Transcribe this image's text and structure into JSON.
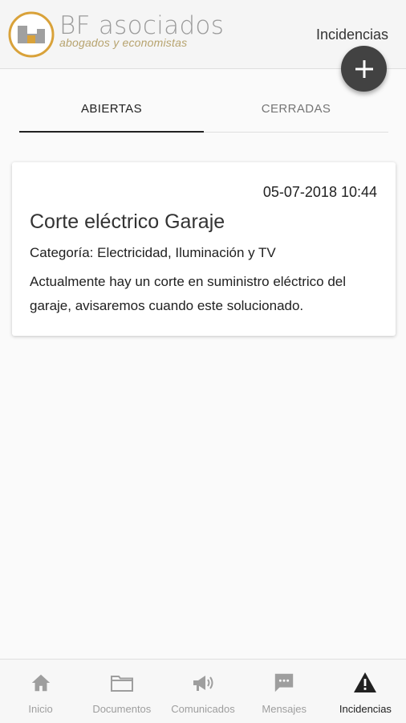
{
  "header": {
    "brand_name": "BF asociados",
    "brand_subtitle": "abogados y economistas",
    "title": "Incidencias"
  },
  "fab": {
    "icon": "plus-icon"
  },
  "tabs": [
    {
      "label": "ABIERTAS",
      "active": true
    },
    {
      "label": "CERRADAS",
      "active": false
    }
  ],
  "incidents": [
    {
      "date": "05-07-2018 10:44",
      "title": "Corte eléctrico Garaje",
      "category": "Categoría: Electricidad, Iluminación y TV",
      "description": "Actualmente hay un corte en suministro eléctrico del garaje, avisaremos cuando este solucionado."
    }
  ],
  "bottom_nav": [
    {
      "label": "Inicio",
      "icon": "home-icon",
      "active": false
    },
    {
      "label": "Documentos",
      "icon": "folder-icon",
      "active": false
    },
    {
      "label": "Comunicados",
      "icon": "megaphone-icon",
      "active": false
    },
    {
      "label": "Mensajes",
      "icon": "chat-icon",
      "active": false
    },
    {
      "label": "Incidencias",
      "icon": "warning-icon",
      "active": true
    }
  ],
  "colors": {
    "accent_dark": "#424242",
    "logo_gold": "#d9a23a",
    "logo_gray": "#a0a0a0",
    "inactive": "#9e9e9e"
  }
}
